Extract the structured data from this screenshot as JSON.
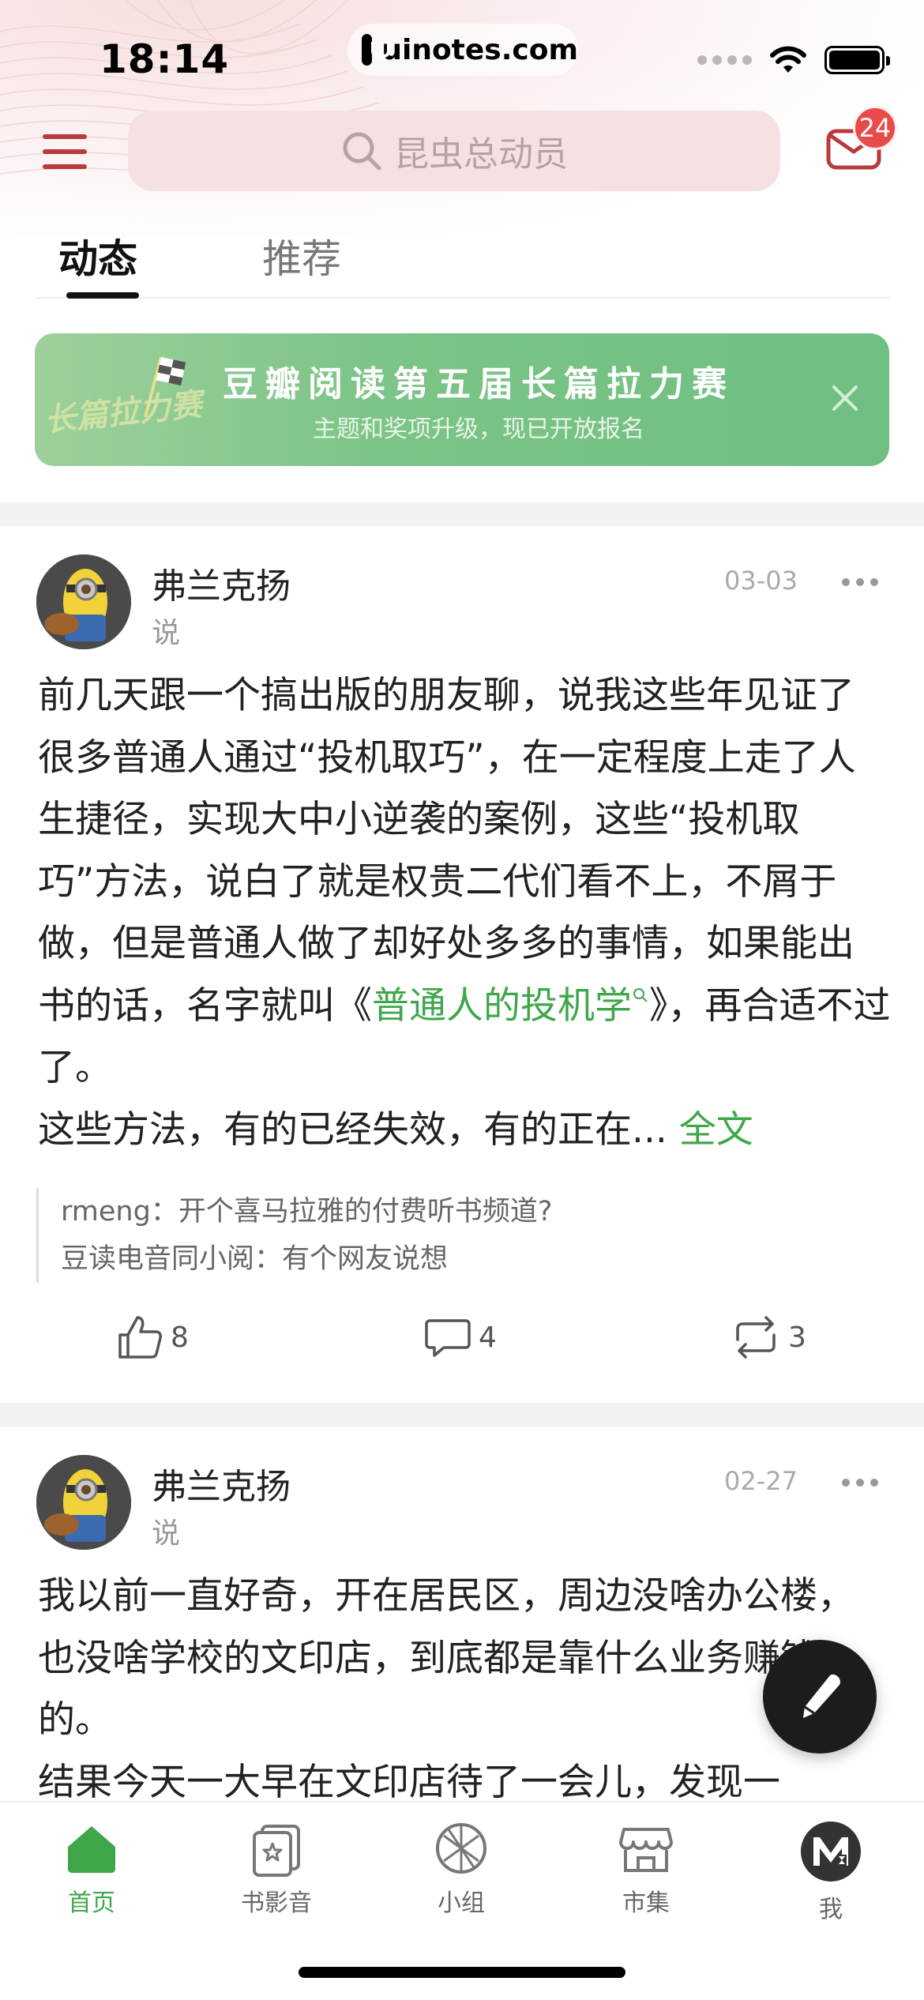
{
  "status_bar": {
    "time": "18:14",
    "url": "uinotes.com"
  },
  "header": {
    "search_placeholder": "昆虫总动员",
    "mail_badge": "24"
  },
  "tabs": [
    {
      "label": "动态"
    },
    {
      "label": "推荐"
    }
  ],
  "banner": {
    "title": "豆瓣阅读第五届长篇拉力赛",
    "subtitle": "主题和奖项升级，现已开放报名",
    "art_text": "长篇拉力赛"
  },
  "posts": [
    {
      "author": "弗兰克扬",
      "verb": "说",
      "date": "03-03",
      "text_1": "前几天跟一个搞出版的朋友聊，说我这些年见证了很多普通人通过“投机取巧”，在一定程度上走了人生捷径，实现大中小逆袭的案例，这些“投机取巧”方法，说白了就是权贵二代们看不上，不屑于做，但是普通人做了却好处多多的事情，如果能出书的话，名字就叫《",
      "link_text": "普通人的投机学",
      "text_2": "》，再合适不过了。",
      "text_3": "这些方法，有的已经失效，有的正在...",
      "full_text_label": "全文",
      "comments": [
        {
          "user": "rmeng：",
          "text": "开个喜马拉雅的付费听书频道?"
        },
        {
          "user": "豆读电音同小阅：",
          "text": "有个网友说想"
        }
      ],
      "likes": "8",
      "replies": "4",
      "reshares": "3"
    },
    {
      "author": "弗兰克扬",
      "verb": "说",
      "date": "02-27",
      "text_1": "我以前一直好奇，开在居民区，周边没啥办公楼，也没啥学校的文印店，到底都是靠什么业务赚钱的。",
      "text_2": "结果今天一大早在文印店待了一会儿，发现一"
    }
  ],
  "tabbar": [
    {
      "label": "首页",
      "icon": "home-icon"
    },
    {
      "label": "书影音",
      "icon": "book-movie-icon"
    },
    {
      "label": "小组",
      "icon": "group-icon"
    },
    {
      "label": "市集",
      "icon": "market-icon"
    },
    {
      "label": "我",
      "icon": "profile-icon"
    }
  ],
  "colors": {
    "accent_green": "#3fa74a",
    "header_red": "#b83a3a",
    "badge_red": "#e94a4a",
    "banner_green": "#7cc487"
  }
}
